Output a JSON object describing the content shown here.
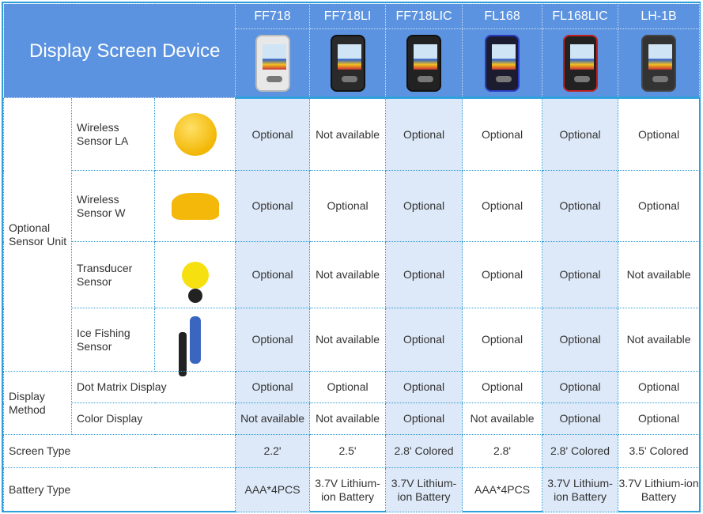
{
  "header": {
    "title": "Display Screen Device",
    "models": [
      "FF718",
      "FF718LI",
      "FF718LIC",
      "FL168",
      "FL168LIC",
      "LH-1B"
    ],
    "device_images": [
      "ff718-device",
      "ff718li-device",
      "ff718lic-device",
      "fl168-device",
      "fl168lic-device",
      "lh1b-device"
    ]
  },
  "highlight_color": "#dde9f8",
  "header_color": "#5b93e0",
  "groups": {
    "sensor": {
      "label": "Optional Sensor Unit",
      "rows": [
        {
          "name": "Wireless Sensor LA",
          "image": "wireless-sensor-la",
          "values": [
            "Optional",
            "Not available",
            "Optional",
            "Optional",
            "Optional",
            "Optional"
          ]
        },
        {
          "name": "Wireless Sensor W",
          "image": "wireless-sensor-w",
          "values": [
            "Optional",
            "Optional",
            "Optional",
            "Optional",
            "Optional",
            "Optional"
          ]
        },
        {
          "name": "Transducer Sensor",
          "image": "transducer-sensor",
          "values": [
            "Optional",
            "Not available",
            "Optional",
            "Optional",
            "Optional",
            "Not available"
          ]
        },
        {
          "name": "Ice Fishing Sensor",
          "image": "ice-fishing-sensor",
          "values": [
            "Optional",
            "Not available",
            "Optional",
            "Optional",
            "Optional",
            "Not available"
          ]
        }
      ]
    },
    "display": {
      "label": "Display Method",
      "rows": [
        {
          "name": "Dot Matrix Display",
          "values": [
            "Optional",
            "Optional",
            "Optional",
            "Optional",
            "Optional",
            "Optional"
          ]
        },
        {
          "name": "Color Display",
          "values": [
            "Not available",
            "Not available",
            "Optional",
            "Not available",
            "Optional",
            "Optional"
          ]
        }
      ]
    }
  },
  "screen_type": {
    "label": "Screen Type",
    "values": [
      "2.2'",
      "2.5'",
      "2.8' Colored",
      "2.8'",
      "2.8' Colored",
      "3.5' Colored"
    ]
  },
  "battery_type": {
    "label": "Battery Type",
    "values": [
      "AAA*4PCS",
      "3.7V Lithium-ion Battery",
      "3.7V Lithium-ion Battery",
      "AAA*4PCS",
      "3.7V Lithium-ion Battery",
      "3.7V Lithium-ion Battery"
    ]
  }
}
